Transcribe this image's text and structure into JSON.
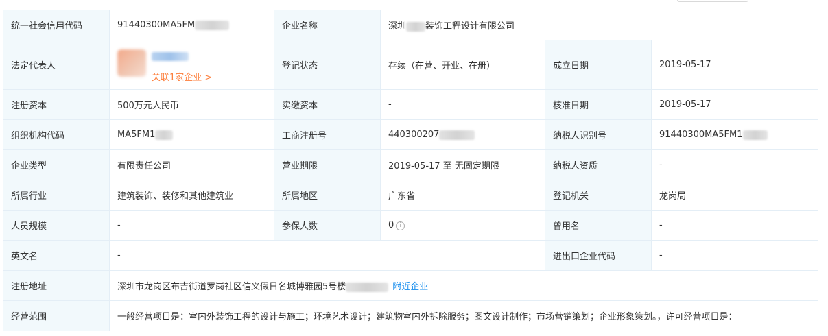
{
  "labels": {
    "credit_code": "统一社会信用代码",
    "company_name": "企业名称",
    "legal_rep": "法定代表人",
    "reg_status": "登记状态",
    "established": "成立日期",
    "reg_capital": "注册资本",
    "paid_capital": "实缴资本",
    "approved_date": "核准日期",
    "org_code": "组织机构代码",
    "biz_reg_no": "工商注册号",
    "taxpayer_id": "纳税人识别号",
    "company_type": "企业类型",
    "biz_term": "营业期限",
    "taxpayer_qual": "纳税人资质",
    "industry": "所属行业",
    "region": "所属地区",
    "reg_authority": "登记机关",
    "staff_size": "人员规模",
    "insured": "参保人数",
    "former_name": "曾用名",
    "english_name": "英文名",
    "import_export_code": "进出口企业代码",
    "address": "注册地址",
    "scope": "经营范围"
  },
  "values": {
    "credit_code": "91440300MA5FM",
    "company_name_prefix": "深圳",
    "company_name_suffix": "装饰工程设计有限公司",
    "related_link": "关联1家企业 >",
    "reg_status": "存续（在营、开业、在册）",
    "established": "2019-05-17",
    "reg_capital": "500万元人民币",
    "paid_capital": "-",
    "approved_date": "2019-05-17",
    "org_code": "MA5FM1",
    "biz_reg_no": "440300207",
    "taxpayer_id": "91440300MA5FM1",
    "company_type": "有限责任公司",
    "biz_term": "2019-05-17 至 无固定期限",
    "taxpayer_qual": "-",
    "industry": "建筑装饰、装修和其他建筑业",
    "region": "广东省",
    "reg_authority": "龙岗局",
    "staff_size": "-",
    "insured": "0",
    "insured_info_icon": "i",
    "former_name": "-",
    "english_name": "-",
    "import_export_code": "-",
    "address": "深圳市龙岗区布吉街道罗岗社区信义假日名城博雅园5号楼",
    "nearby_link": "附近企业",
    "scope": "一般经营项目是：室内外装饰工程的设计与施工；环境艺术设计；建筑物室内外拆除服务；图文设计制作；市场营销策划；企业形象策划。，许可经营项目是："
  },
  "colors": {
    "label_bg": "#f2f9fc",
    "border": "#e4eef6",
    "link": "#128bed",
    "related": "#fd7e3b"
  }
}
